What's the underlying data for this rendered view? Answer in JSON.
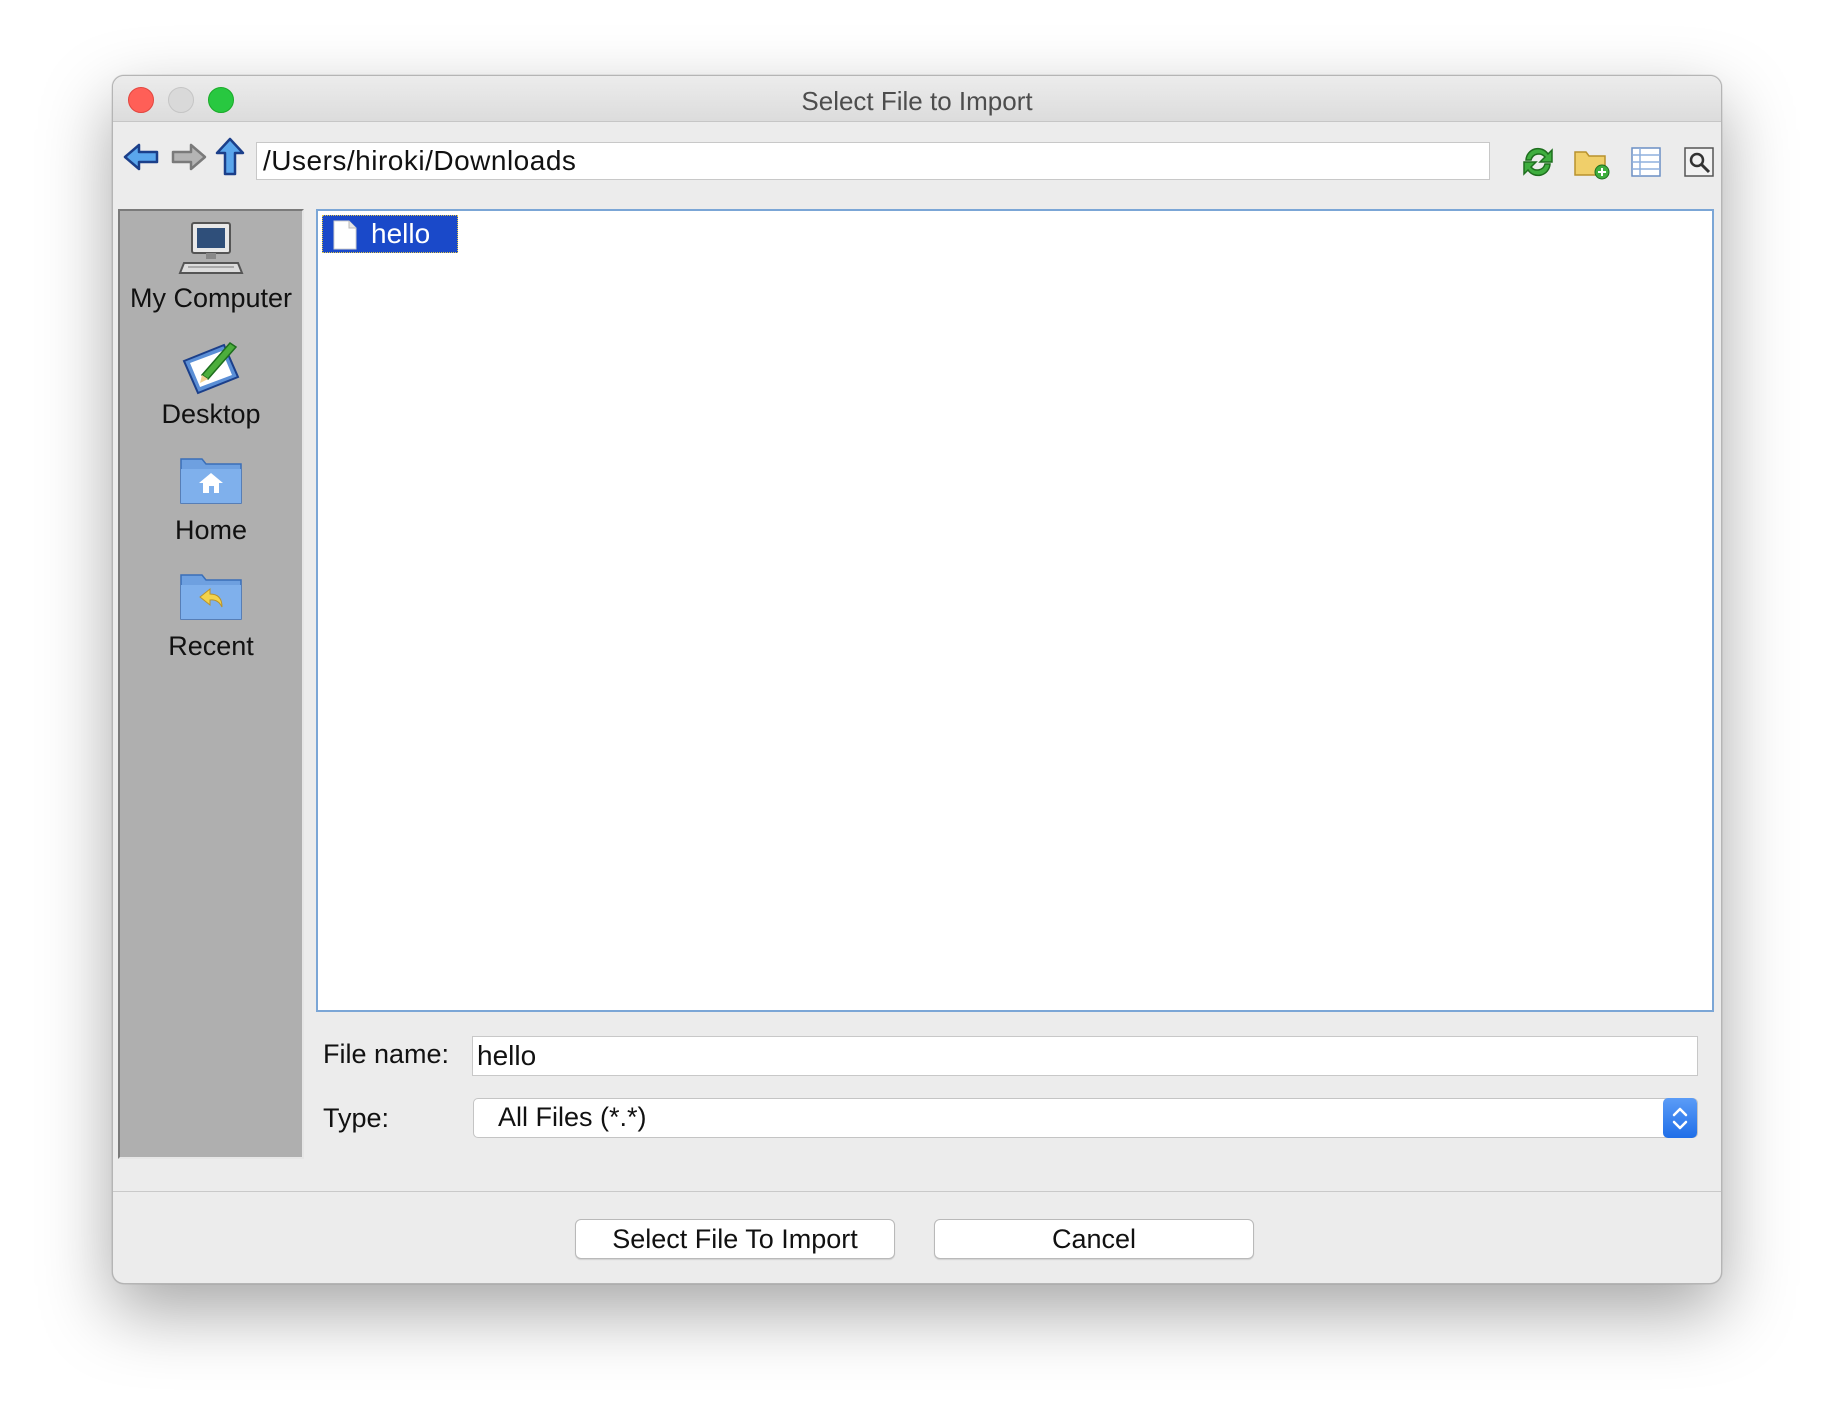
{
  "window": {
    "title": "Select File to Import"
  },
  "toolbar": {
    "path": "/Users/hiroki/Downloads",
    "icons": [
      "back-arrow-icon",
      "forward-arrow-icon",
      "up-folder-icon",
      "refresh-icon",
      "new-folder-icon",
      "list-view-icon",
      "details-view-icon"
    ]
  },
  "sidebar": {
    "items": [
      {
        "label": "My Computer",
        "icon": "computer-icon"
      },
      {
        "label": "Desktop",
        "icon": "desktop-icon"
      },
      {
        "label": "Home",
        "icon": "home-folder-icon"
      },
      {
        "label": "Recent",
        "icon": "recent-folder-icon"
      }
    ]
  },
  "files": [
    {
      "name": "hello",
      "selected": true,
      "icon": "file-icon"
    }
  ],
  "form": {
    "file_name_label": "File name:",
    "file_name_value": "hello",
    "type_label": "Type:",
    "type_value": "All Files (*.*)"
  },
  "buttons": {
    "import": "Select File To Import",
    "cancel": "Cancel"
  },
  "colors": {
    "selection": "#1a49c9",
    "sidebar": "#afafaf",
    "list_border": "#7ba6d6",
    "close": "#ff5f57",
    "maximize": "#28c840"
  }
}
